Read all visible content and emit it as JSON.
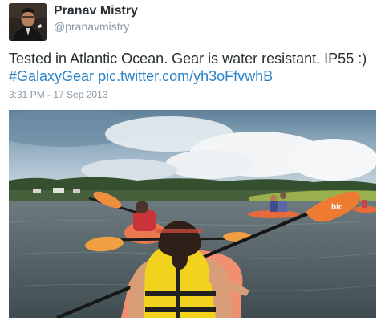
{
  "user": {
    "name": "Pranav Mistry",
    "handle": "@pranavmistry",
    "avatar_icon": "user-avatar-photo"
  },
  "tweet": {
    "text": "Tested in Atlantic Ocean. Gear is water resistant. IP55 :)",
    "hashtag": "#GalaxyGear",
    "media_link": "pic.twitter.com/yh3oFfvwhB",
    "timestamp": "3:31 PM - 17 Sep 2013"
  },
  "photo": {
    "paddle_logo": "bic"
  },
  "colors": {
    "link": "#2a82c7",
    "meta": "#8899a6",
    "text": "#292f33",
    "vest": "#f1d21c",
    "paddle": "#ee7b32"
  }
}
